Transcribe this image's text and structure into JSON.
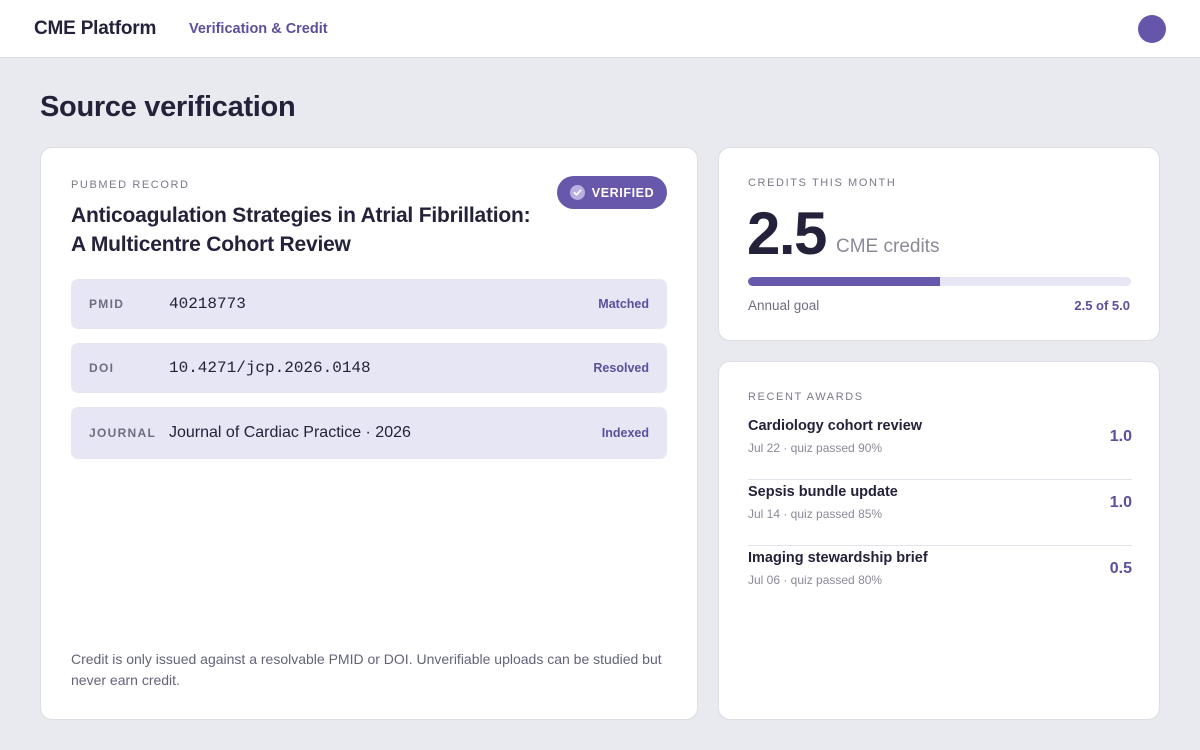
{
  "header": {
    "brand": "CME Platform",
    "nav_link": "Verification & Credit",
    "avatar_color": "#6656a9"
  },
  "page": {
    "title": "Source verification"
  },
  "record": {
    "eyebrow": "PUBMED RECORD",
    "badge": "VERIFIED",
    "title": "Anticoagulation Strategies in Atrial Fibrillation: A Multicentre Cohort Review",
    "rows": [
      {
        "key": "PMID",
        "value": "40218773",
        "status": "Matched"
      },
      {
        "key": "DOI",
        "value": "10.4271/jcp.2026.0148",
        "status": "Resolved"
      },
      {
        "key": "JOURNAL",
        "value": "Journal of Cardiac Practice · 2026",
        "status": "Indexed"
      }
    ],
    "footnote": "Credit is only issued against a resolvable PMID or DOI. Unverifiable uploads can be studied but never earn credit."
  },
  "credits": {
    "eyebrow": "CREDITS THIS MONTH",
    "amount": "2.5",
    "unit": "CME credits",
    "goal_label": "Annual goal",
    "goal_value": "2.5 of 5.0",
    "progress_fraction": 0.5
  },
  "awards": {
    "eyebrow": "RECENT AWARDS",
    "items": [
      {
        "title": "Cardiology cohort review",
        "meta": "Jul 22 · quiz passed 90%",
        "credit": "1.0"
      },
      {
        "title": "Sepsis bundle update",
        "meta": "Jul 14 · quiz passed 85%",
        "credit": "1.0"
      },
      {
        "title": "Imaging stewardship brief",
        "meta": "Jul 06 · quiz passed 80%",
        "credit": "0.5"
      }
    ]
  },
  "colors": {
    "accent": "#6758ab",
    "accent_text": "#5b4f9e",
    "background": "#e9e9f0",
    "row_background": "#e6e6f4"
  }
}
